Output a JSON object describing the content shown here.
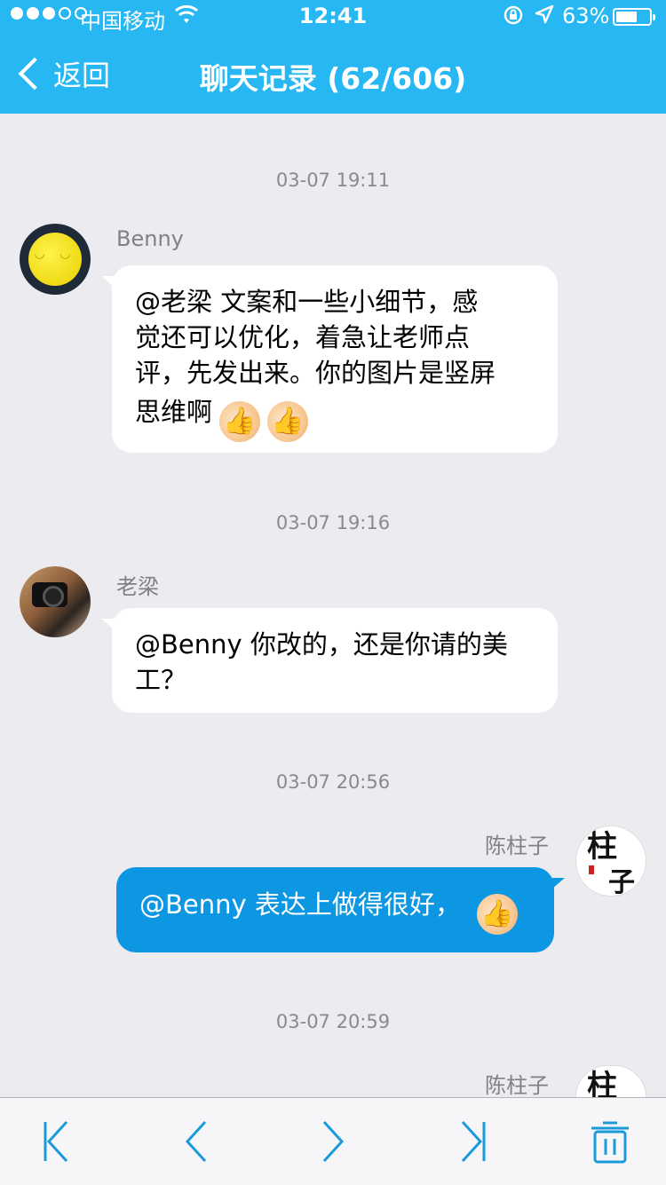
{
  "status_bar": {
    "carrier": "中国移动",
    "time": "12:41",
    "battery": "63%",
    "battery_level": 0.63
  },
  "nav": {
    "back_label": "返回",
    "title": "聊天记录 (62/606)"
  },
  "messages": [
    {
      "timestamp": "03-07 19:11",
      "sender": "Benny",
      "direction": "incoming",
      "lines": [
        "@老梁 文案和一些小细节，感",
        "觉还可以优化，着急让老师点",
        "评，先发出来。你的图片是竖屏",
        "思维啊"
      ],
      "emoji": "thumbs-up x2"
    },
    {
      "timestamp": "03-07 19:16",
      "sender": "老梁",
      "direction": "incoming",
      "lines": [
        "@Benny 你改的，还是你请的美",
        "工？"
      ]
    },
    {
      "timestamp": "03-07 20:56",
      "sender": "陈柱子",
      "direction": "outgoing",
      "lines": [
        "@Benny 表达上做得很好，"
      ],
      "emoji": "thumbs-up"
    },
    {
      "timestamp": "03-07 20:59",
      "sender": "陈柱子",
      "direction": "outgoing"
    }
  ],
  "toolbar": {
    "icons": [
      "first-page-icon",
      "previous-page-icon",
      "next-page-icon",
      "last-page-icon",
      "trash-icon"
    ]
  },
  "colors": {
    "nav_bg": "#27b7f2",
    "outgoing_bubble": "#0d97e3",
    "incoming_bubble": "#ffffff",
    "background": "#ebebf0",
    "toolbar_icon": "#1a9ad8"
  }
}
